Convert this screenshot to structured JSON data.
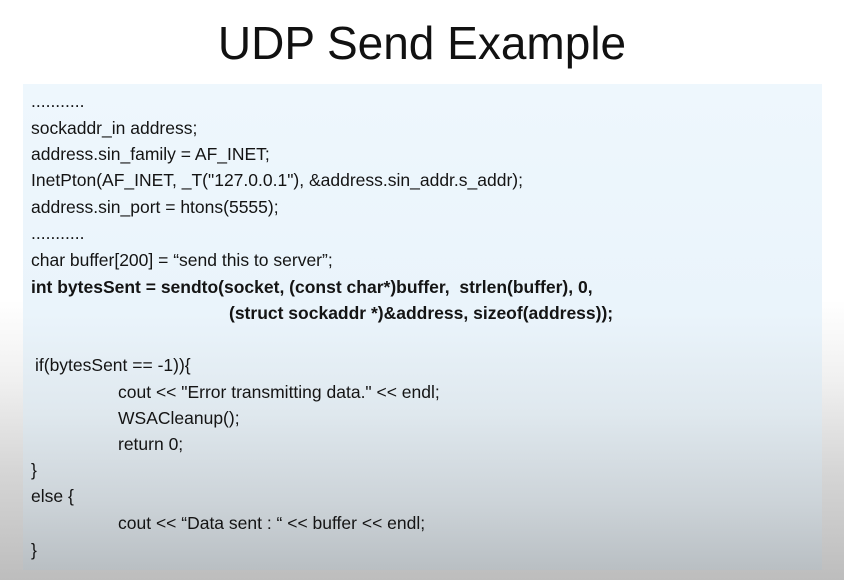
{
  "slide": {
    "title": "UDP Send Example"
  },
  "code": {
    "lines": [
      "...........",
      "sockaddr_in address;",
      "address.sin_family = AF_INET;",
      "InetPton(AF_INET, _T(\"127.0.0.1\"), &address.sin_addr.s_addr);",
      "address.sin_port = htons(5555);",
      "...........",
      "char buffer[200] = “send this to server”;",
      "int bytesSent = sendto(socket, (const char*)buffer,  strlen(buffer), 0,",
      "(struct sockaddr *)&address, sizeof(address));",
      "if(bytesSent == -1)){",
      "cout << \"Error transmitting data.\" << endl;",
      "WSACleanup();",
      "return 0;",
      "}",
      "else {",
      "cout << “Data sent : “ << buffer << endl;",
      "}"
    ]
  }
}
